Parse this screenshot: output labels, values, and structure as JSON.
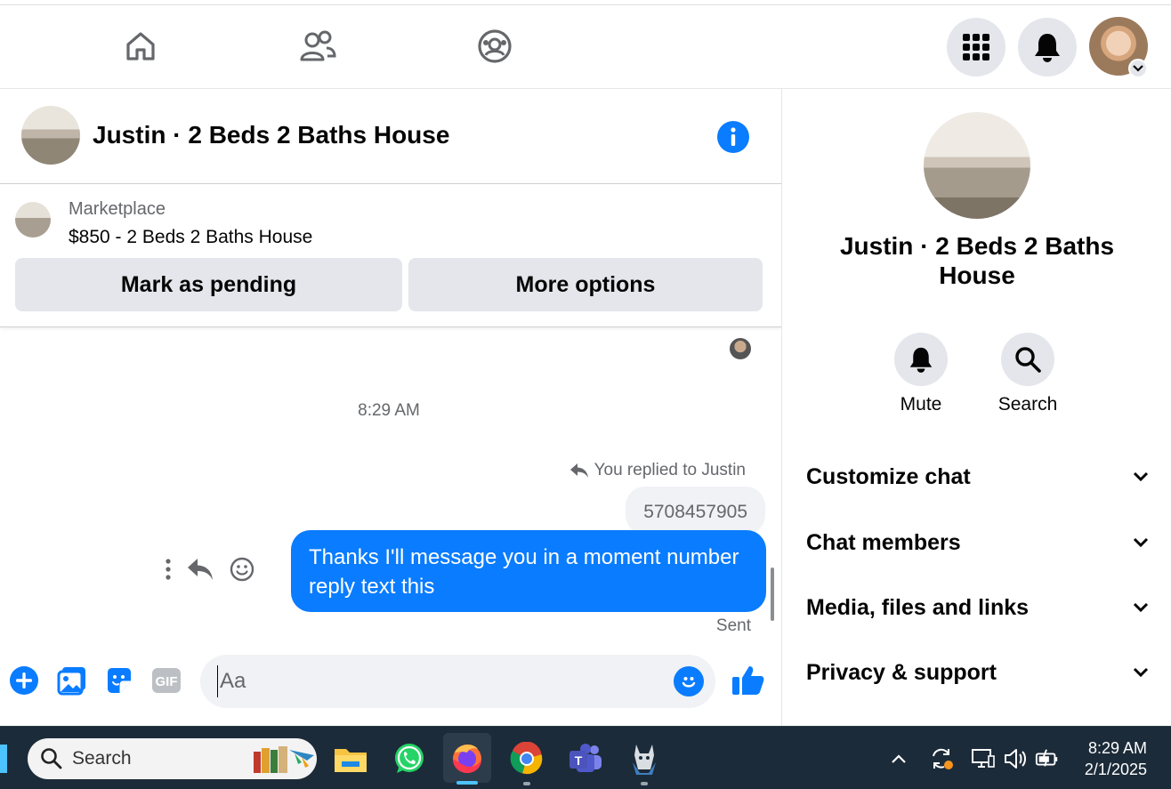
{
  "top_nav": {
    "icons": [
      "home-icon",
      "friends-icon",
      "groups-icon",
      "menu-grid-icon",
      "notifications-icon",
      "profile-avatar"
    ]
  },
  "chat": {
    "title": "Justin · 2 Beds 2 Baths House",
    "marketplace": {
      "label": "Marketplace",
      "item": "$850 - 2 Beds 2 Baths House",
      "mark_pending": "Mark as pending",
      "more_options": "More options"
    },
    "messages": {
      "timestamp": "8:29 AM",
      "replied_to": "You replied to Justin",
      "quoted_text": "5708457905",
      "message_text": "Thanks I'll message you in a moment number reply text this",
      "status": "Sent"
    },
    "composer": {
      "placeholder": "Aa"
    }
  },
  "panel": {
    "title": "Justin · 2 Beds 2 Baths House",
    "mute_label": "Mute",
    "search_label": "Search",
    "sections": [
      "Customize chat",
      "Chat members",
      "Media, files and links",
      "Privacy & support"
    ]
  },
  "taskbar": {
    "search_label": "Search",
    "time": "8:29 AM",
    "date": "2/1/2025"
  },
  "colors": {
    "accent": "#0a7cff",
    "button_bg": "#e4e6eb",
    "taskbar_bg": "#1c2b39"
  }
}
